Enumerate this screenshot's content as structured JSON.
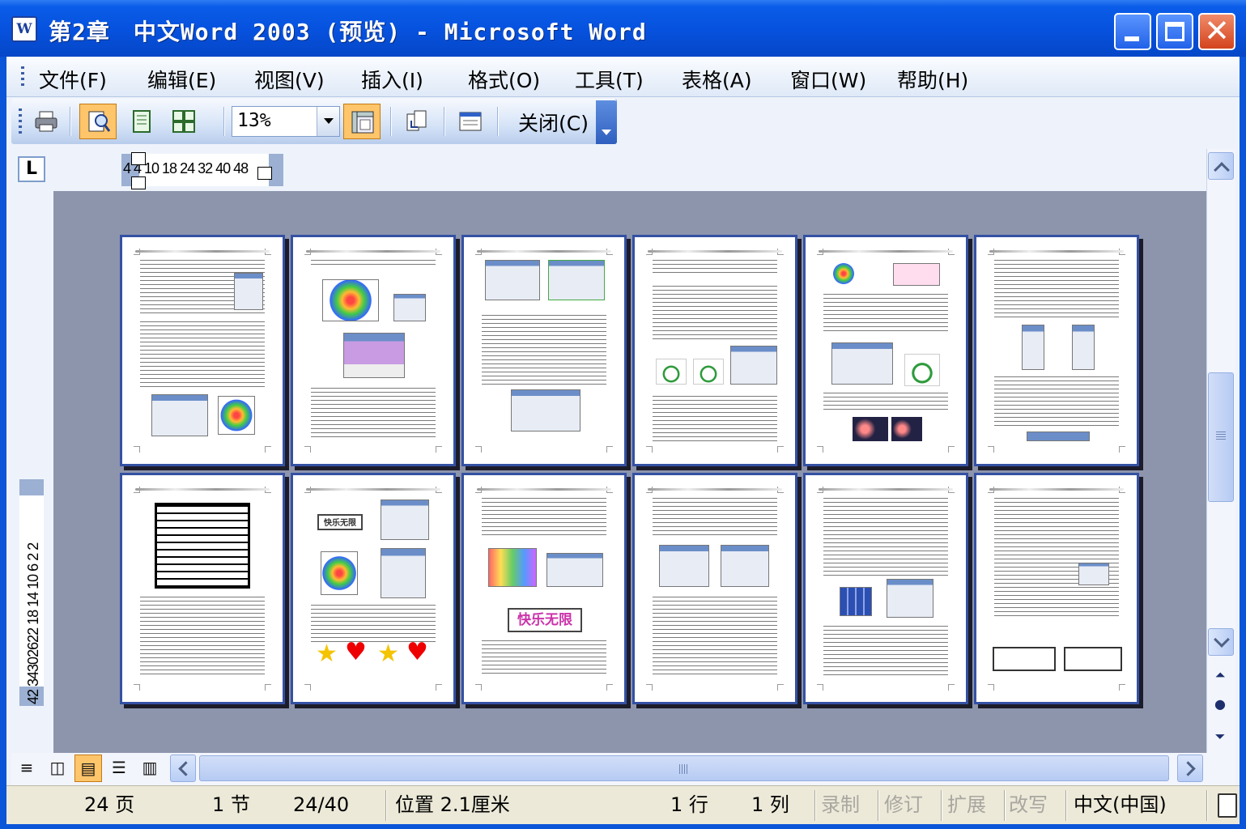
{
  "window": {
    "title": "第2章　中文Word 2003 (预览) - Microsoft Word",
    "app_icon_label": "W"
  },
  "menu": {
    "items": [
      "文件(F)",
      "编辑(E)",
      "视图(V)",
      "插入(I)",
      "格式(O)",
      "工具(T)",
      "表格(A)",
      "窗口(W)",
      "帮助(H)"
    ]
  },
  "toolbar": {
    "zoom": "13%",
    "close_label": "关闭(C)",
    "icons": [
      "print-icon",
      "magnifier-icon",
      "one-page-icon",
      "multiple-pages-icon",
      "view-ruler-icon",
      "shrink-to-fit-icon",
      "full-screen-icon"
    ]
  },
  "rulers": {
    "tab_selector": "L",
    "horizontal_ticks": "4 4 10 18 24 32 40 48",
    "vertical_ticks": "42 34302622 18 14 10 6 2 2"
  },
  "pages": {
    "count": 12,
    "banner_text": "快乐无限",
    "small_banner": "快乐无限"
  },
  "statusbar": {
    "page": "24 页",
    "section": "1 节",
    "page_of": "24/40",
    "position": "位置 2.1厘米",
    "line": "1 行",
    "column": "1 列",
    "rec": "录制",
    "trk": "修订",
    "ext": "扩展",
    "ovr": "改写",
    "language": "中文(中国)"
  },
  "colors": {
    "titlebar": "#0651dd",
    "active_button": "#ffc56b",
    "doc_background": "#8d95ad",
    "page_border": "#3451a3"
  }
}
